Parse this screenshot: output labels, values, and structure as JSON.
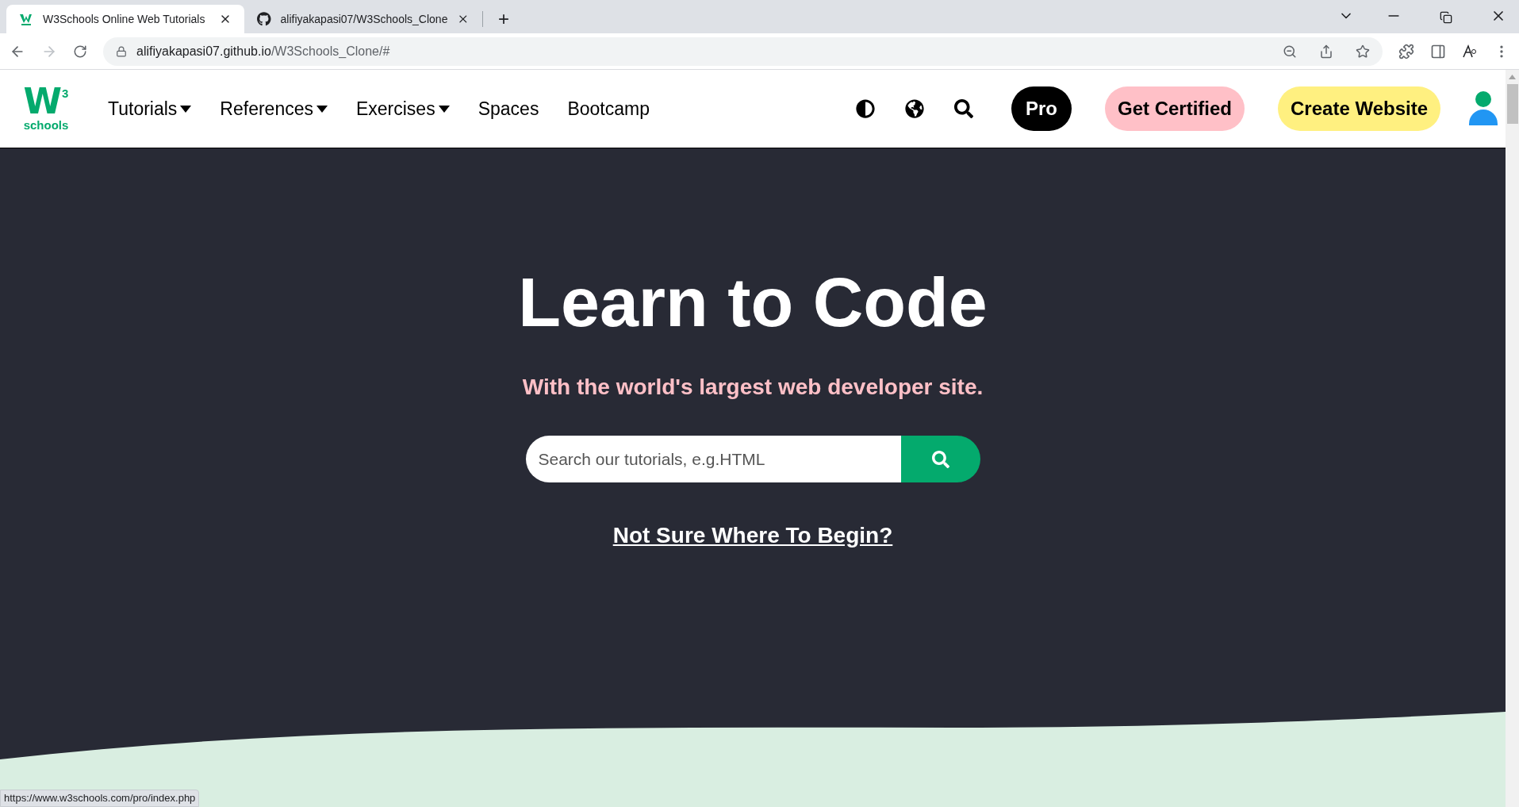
{
  "browser": {
    "tabs": [
      {
        "title": "W3Schools Online Web Tutorials",
        "selected": true
      },
      {
        "title": "alifiyakapasi07/W3Schools_Clone",
        "selected": false
      }
    ],
    "new_tab": "+",
    "url_host": "alifiyakapasi07.github.io",
    "url_path": "/W3Schools_Clone/#",
    "status_url": "https://www.w3schools.com/pro/index.php"
  },
  "nav": {
    "logo": {
      "letter": "W",
      "sup": "3",
      "word": "schools"
    },
    "items": [
      {
        "label": "Tutorials",
        "dropdown": true
      },
      {
        "label": "References",
        "dropdown": true
      },
      {
        "label": "Exercises",
        "dropdown": true
      },
      {
        "label": "Spaces",
        "dropdown": false
      },
      {
        "label": "Bootcamp",
        "dropdown": false
      }
    ],
    "buttons": [
      {
        "label": "Pro",
        "color": "#000000"
      },
      {
        "label": "Get Certified",
        "color": "#ffc0c7"
      },
      {
        "label": "Create Website",
        "color": "#fff080"
      }
    ]
  },
  "hero": {
    "title": "Learn to Code",
    "subtitle": "With the world's largest web developer site.",
    "search": {
      "placeholder": "Search our tutorials, e.g.HTML"
    },
    "link": "Not Sure Where To Begin?"
  }
}
